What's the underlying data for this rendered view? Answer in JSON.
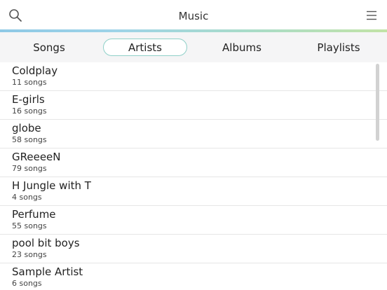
{
  "app": {
    "title": "Music"
  },
  "header": {
    "search_icon": "search-icon",
    "menu_icon": "hamburger-menu-icon"
  },
  "colors": {
    "accent_border": "#8fd0c8",
    "tab_bar_bg": "#f5f5f6"
  },
  "tabs": [
    {
      "label": "Songs",
      "active": false
    },
    {
      "label": "Artists",
      "active": true
    },
    {
      "label": "Albums",
      "active": false
    },
    {
      "label": "Playlists",
      "active": false
    }
  ],
  "artists": [
    {
      "name": "Coldplay",
      "count": "11 songs"
    },
    {
      "name": "E-girls",
      "count": "16 songs"
    },
    {
      "name": "globe",
      "count": "58 songs"
    },
    {
      "name": "GReeeeN",
      "count": "79 songs"
    },
    {
      "name": "H Jungle with T",
      "count": "4 songs"
    },
    {
      "name": "Perfume",
      "count": "55 songs"
    },
    {
      "name": "pool bit boys",
      "count": "23 songs"
    },
    {
      "name": "Sample Artist",
      "count": "6 songs"
    }
  ]
}
